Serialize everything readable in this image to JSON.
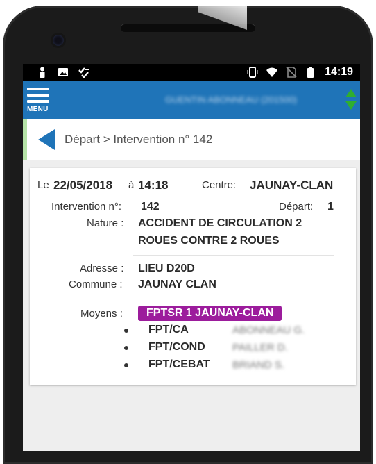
{
  "status_bar": {
    "time": "14:19",
    "left_icons": [
      "person-icon",
      "image-icon",
      "checklist-icon"
    ],
    "right_icons": [
      "vibrate-icon",
      "wifi-icon",
      "no-sim-icon",
      "battery-icon"
    ]
  },
  "app_bar": {
    "menu_label": "MENU",
    "user_title": "GUENTIN ABONNEAU (201500)",
    "nav_icon": "up-down-arrows-icon",
    "colors": {
      "app_bar": "#1f74b8",
      "accent": "#2fae2f"
    }
  },
  "breadcrumb": {
    "text": "Départ > Intervention n° 142",
    "back_icon": "back-triangle-icon",
    "accent_color": "#b6e3a8"
  },
  "intervention": {
    "date_prefix": "Le",
    "date": "22/05/2018",
    "date_sep": "à",
    "time": "14:18",
    "centre_label": "Centre:",
    "centre_value": "JAUNAY-CLAN",
    "number_label": "Intervention n°:",
    "number_value": "142",
    "depart_label": "Départ:",
    "depart_value": "1",
    "nature_label": "Nature :",
    "nature_line1": "ACCIDENT DE CIRCULATION 2",
    "nature_line2": "ROUES CONTRE 2 ROUES",
    "adresse_label": "Adresse :",
    "adresse_value": "LIEU D20D",
    "commune_label": "Commune :",
    "commune_value": "JAUNAY CLAN",
    "moyens_label": "Moyens :",
    "moyens_badge": "FPTSR 1 JAUNAY-CLAN",
    "badge_color": "#9c1c9c",
    "crew": [
      {
        "role": "FPT/CA",
        "name": "ABONNEAU G."
      },
      {
        "role": "FPT/COND",
        "name": "PAILLER D."
      },
      {
        "role": "FPT/CEBAT",
        "name": "BRIAND S."
      }
    ]
  }
}
